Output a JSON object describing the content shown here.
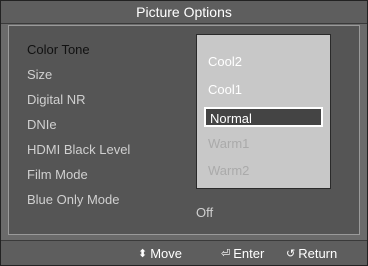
{
  "title": "Picture Options",
  "menu_items": [
    {
      "label": "Color Tone",
      "active": true
    },
    {
      "label": "Size",
      "active": false
    },
    {
      "label": "Digital NR",
      "active": false
    },
    {
      "label": "DNIe",
      "active": false
    },
    {
      "label": "HDMI Black Level",
      "active": false
    },
    {
      "label": "Film Mode",
      "active": false
    },
    {
      "label": "Blue Only Mode",
      "active": false
    }
  ],
  "dropdown_options": [
    {
      "label": "Cool2",
      "state": "normal"
    },
    {
      "label": "Cool1",
      "state": "normal"
    },
    {
      "label": "Normal",
      "state": "selected"
    },
    {
      "label": "Warm1",
      "state": "dim"
    },
    {
      "label": "Warm2",
      "state": "dim"
    }
  ],
  "blue_only_value": "Off",
  "footer": {
    "move": "Move",
    "enter": "Enter",
    "return": "Return"
  }
}
